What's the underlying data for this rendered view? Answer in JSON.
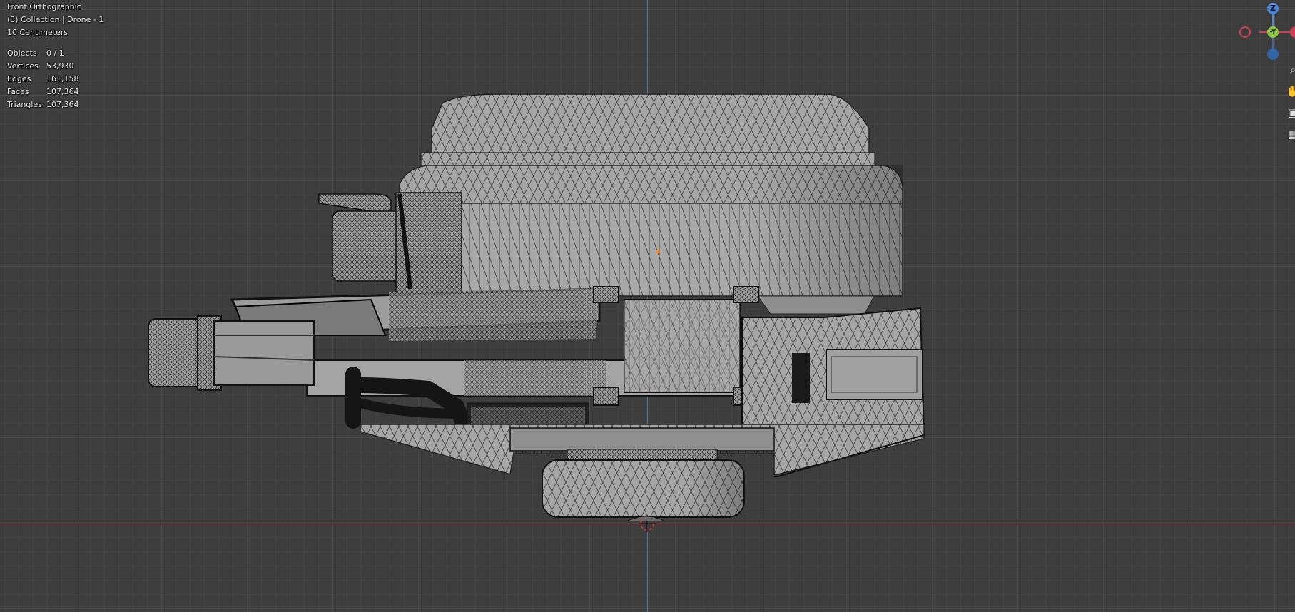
{
  "viewport": {
    "view_name": "Front Orthographic",
    "collection_info": "(3) Collection | Drone - 1",
    "grid_scale": "10 Centimeters"
  },
  "statistics": [
    {
      "label": "Objects",
      "value": "0 / 1"
    },
    {
      "label": "Vertices",
      "value": "53,930"
    },
    {
      "label": "Edges",
      "value": "161,158"
    },
    {
      "label": "Faces",
      "value": "107,364"
    },
    {
      "label": "Triangles",
      "value": "107,364"
    }
  ],
  "gizmo": {
    "z_label": "Z",
    "y_label": "-Y",
    "colors": {
      "z": "#4a86d8",
      "y": "#8cc63f",
      "x": "#e04050",
      "z_neg": "#3465a8"
    }
  },
  "nav_icons": [
    "zoom-icon",
    "pan-hand-icon",
    "camera-icon",
    "grid-icon"
  ],
  "colors": {
    "background": "#3d3d3d",
    "x_axis": "#b54550",
    "z_axis": "#3f73b8",
    "mesh": "#a9a9a9"
  }
}
